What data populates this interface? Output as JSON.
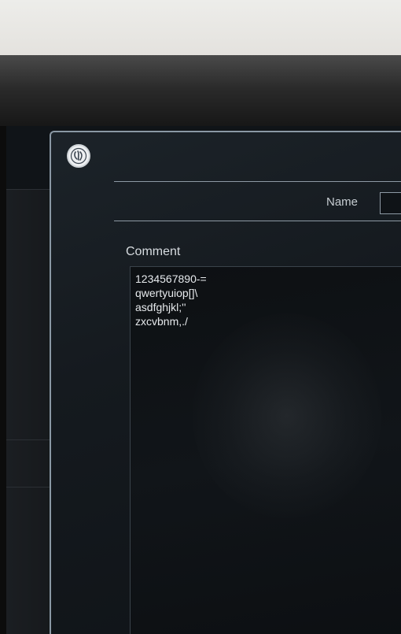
{
  "dialog": {
    "logo_icon": "ge-logo-icon",
    "name_label": "Name",
    "name_value": "",
    "comment_label": "Comment",
    "comment_lines": [
      "1234567890-=",
      "qwertyuiop[]\\",
      "asdfghjkl;''",
      "zxcvbnm,./"
    ]
  },
  "colors": {
    "dialog_border": "#8a98a4",
    "screen_background": "#101418",
    "text": "#e6e9ec"
  }
}
